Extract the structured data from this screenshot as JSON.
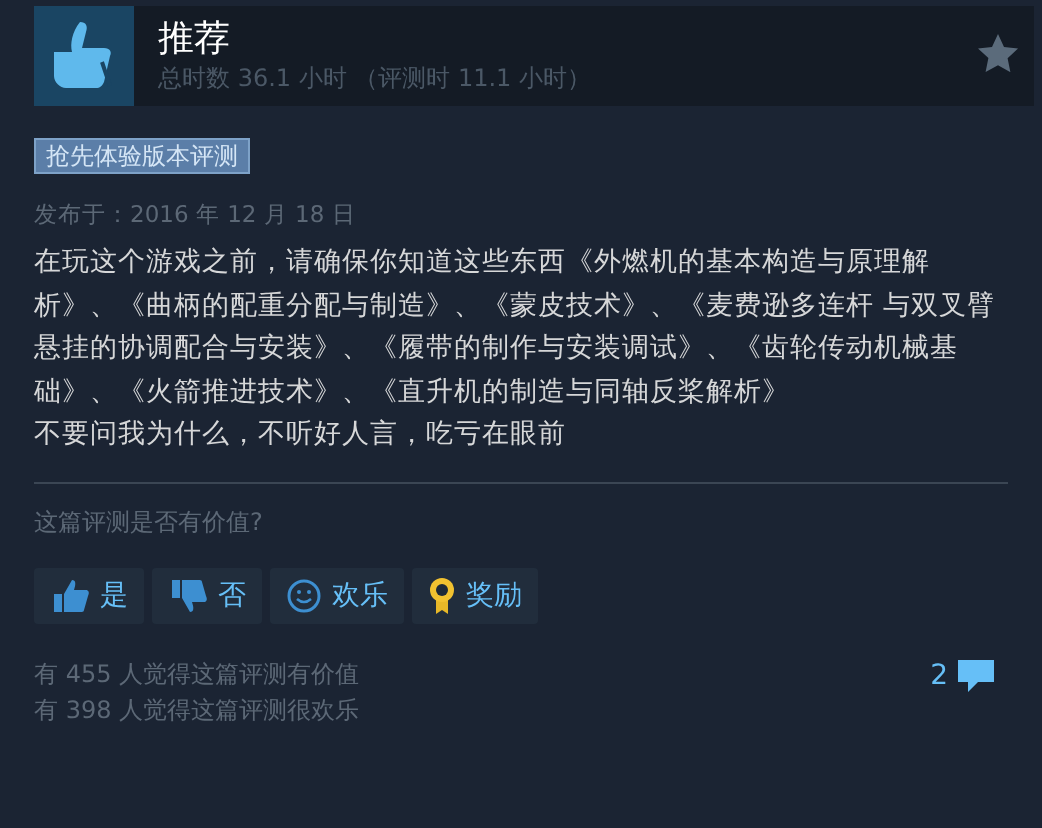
{
  "header": {
    "title": "推荐",
    "playtime": "总时数 36.1 小时 （评测时 11.1 小时）"
  },
  "tag": "抢先体验版本评测",
  "posted": "发布于：2016 年 12 月 18 日",
  "body": [
    "在玩这个游戏之前，请确保你知道这些东西《外燃机的基本构造与原理解析》、《曲柄的配重分配与制造》、《蒙皮技术》、《麦费逊多连杆 与双叉臂悬挂的协调配合与安装》、《履带的制作与安装调试》、《齿轮传动机械基础》、《火箭推进技术》、《直升机的制造与同轴反桨解析》",
    "不要问我为什么，不听好人言，吃亏在眼前"
  ],
  "question": "这篇评测是否有价值?",
  "buttons": [
    {
      "kind": "yes",
      "label": "是"
    },
    {
      "kind": "no",
      "label": "否"
    },
    {
      "kind": "funny",
      "label": "欢乐"
    },
    {
      "kind": "award",
      "label": "奖励"
    }
  ],
  "stats": [
    "有 455 人觉得这篇评测有价值",
    "有 398 人觉得这篇评测很欢乐"
  ],
  "comments": "2"
}
